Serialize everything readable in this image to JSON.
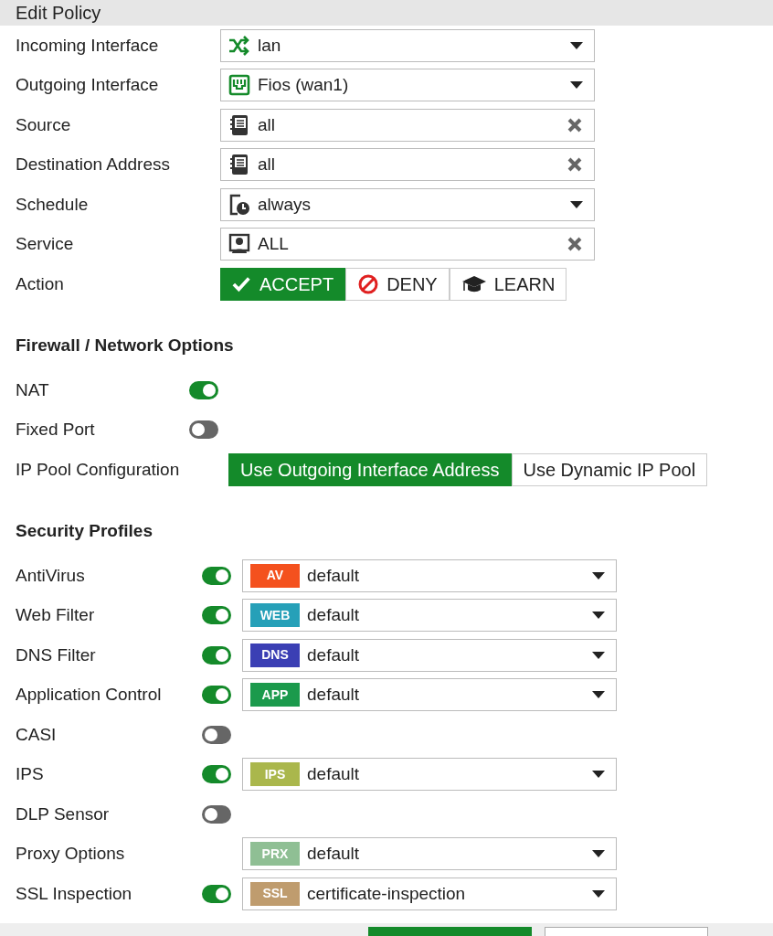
{
  "title": "Edit Policy",
  "fields": [
    {
      "label": "Incoming Interface",
      "kind": "select",
      "value": "lan"
    },
    {
      "label": "Outgoing Interface",
      "kind": "select",
      "value": "Fios (wan1)"
    },
    {
      "label": "Source",
      "kind": "multi",
      "value": "all"
    },
    {
      "label": "Destination Address",
      "kind": "multi",
      "value": "all"
    },
    {
      "label": "Schedule",
      "kind": "select",
      "value": "always"
    },
    {
      "label": "Service",
      "kind": "multi",
      "value": "ALL"
    }
  ],
  "action": {
    "label": "Action",
    "options": [
      {
        "label": "ACCEPT",
        "selected": true
      },
      {
        "label": "DENY",
        "selected": false
      },
      {
        "label": "LEARN",
        "selected": false
      }
    ]
  },
  "firewall": {
    "title": "Firewall / Network Options",
    "toggles": [
      {
        "label": "NAT",
        "on": true
      },
      {
        "label": "Fixed Port",
        "on": false
      }
    ],
    "ip_pool": {
      "label": "IP Pool Configuration",
      "options": [
        {
          "label": "Use Outgoing Interface Address",
          "selected": true
        },
        {
          "label": "Use Dynamic IP Pool",
          "selected": false
        }
      ]
    }
  },
  "security": {
    "title": "Security Profiles",
    "profiles": [
      {
        "label": "AntiVirus",
        "kind": "toggle",
        "on": true,
        "badge": "AV",
        "color": "#f4511e",
        "value": "default"
      },
      {
        "label": "Web Filter",
        "kind": "toggle",
        "on": true,
        "badge": "WEB",
        "color": "#26a0b8",
        "value": "default"
      },
      {
        "label": "DNS Filter",
        "kind": "toggle",
        "on": true,
        "badge": "DNS",
        "color": "#3b3fb4",
        "value": "default"
      },
      {
        "label": "Application Control",
        "kind": "toggle",
        "on": true,
        "badge": "APP",
        "color": "#1b9a4c",
        "value": "default"
      },
      {
        "label": "CASI",
        "kind": "toggle",
        "on": false
      },
      {
        "label": "IPS",
        "kind": "toggle",
        "on": true,
        "badge": "IPS",
        "color": "#aab74c",
        "value": "default"
      },
      {
        "label": "DLP Sensor",
        "kind": "toggle",
        "on": false
      },
      {
        "label": "Proxy Options",
        "kind": "plain",
        "badge": "PRX",
        "color": "#8fbf94",
        "value": "default"
      },
      {
        "label": "SSL Inspection",
        "kind": "toggle",
        "on": true,
        "badge": "SSL",
        "color": "#bf9c6e",
        "value": "certificate-inspection"
      }
    ]
  }
}
